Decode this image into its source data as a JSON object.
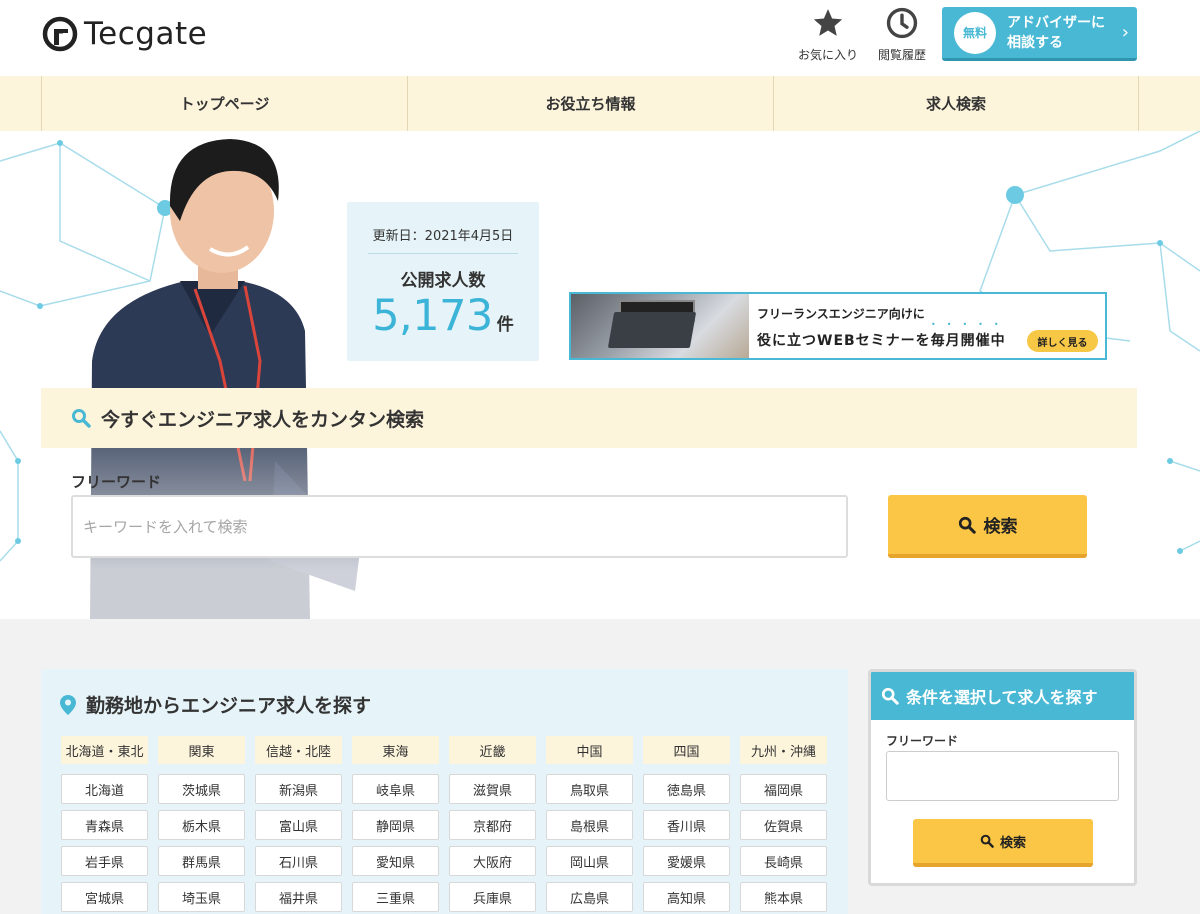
{
  "header": {
    "logo_text": "Tecgate",
    "favorites_label": "お気に入り",
    "history_label": "閲覧履歴",
    "advisor_badge": "無料",
    "advisor_label": "アドバイザーに相談する"
  },
  "nav": {
    "items": [
      {
        "label": "トップページ"
      },
      {
        "label": "お役立ち情報"
      },
      {
        "label": "求人検索"
      }
    ]
  },
  "hero": {
    "updated": "更新日：2021年4月5日",
    "jobs_label": "公開求人数",
    "jobs_count": "5,173",
    "jobs_unit": "件",
    "banner": {
      "line1": "フリーランスエンジニア向けに",
      "line2": "役に立つWEBセミナーを毎月開催中",
      "button": "詳しく見る"
    },
    "search_heading": "今すぐエンジニア求人をカンタン検索",
    "freeword_label": "フリーワード",
    "freeword_placeholder": "キーワードを入れて検索",
    "search_button": "検索"
  },
  "location": {
    "title": "勤務地からエンジニア求人を探す",
    "regions": [
      "北海道・東北",
      "関東",
      "信越・北陸",
      "東海",
      "近畿",
      "中国",
      "四国",
      "九州・沖縄"
    ],
    "prefectures": [
      "北海道",
      "茨城県",
      "新潟県",
      "岐阜県",
      "滋賀県",
      "鳥取県",
      "徳島県",
      "福岡県",
      "青森県",
      "栃木県",
      "富山県",
      "静岡県",
      "京都府",
      "島根県",
      "香川県",
      "佐賀県",
      "岩手県",
      "群馬県",
      "石川県",
      "愛知県",
      "大阪府",
      "岡山県",
      "愛媛県",
      "長崎県",
      "宮城県",
      "埼玉県",
      "福井県",
      "三重県",
      "兵庫県",
      "広島県",
      "高知県",
      "熊本県"
    ]
  },
  "conditions": {
    "title": "条件を選択して求人を探す",
    "freeword_label": "フリーワード",
    "search_button": "検索"
  },
  "colors": {
    "accent": "#49b8d4",
    "cream": "#fdf4dc",
    "button_yellow": "#fbc646",
    "light_blue": "#e6f4f9"
  },
  "icons": [
    "logo-icon",
    "star-icon",
    "clock-icon",
    "chevron-right-icon",
    "search-icon",
    "location-pin-icon"
  ]
}
